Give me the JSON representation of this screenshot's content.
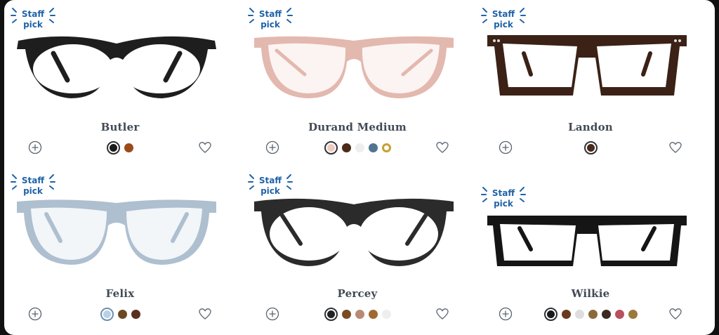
{
  "badge": {
    "line1": "Staff",
    "line2": "pick"
  },
  "products": [
    {
      "name": "Butler",
      "staff_pick": true,
      "frame_color": "#1e1e1e",
      "lens_tint": "none",
      "swatches": [
        "#1b1b1b",
        "#9b4a18"
      ],
      "selected": 0
    },
    {
      "name": "Durand Medium",
      "staff_pick": true,
      "frame_color": "#e3b8ae",
      "lens_tint": "none",
      "swatches": [
        "#f1c9c1",
        "#4a2a18",
        "#eeeeee",
        "#4f7590",
        "#c99f34"
      ],
      "selected": 0
    },
    {
      "name": "Landon",
      "staff_pick": true,
      "frame_color": "#3b2116",
      "lens_tint": "none",
      "swatches": [
        "#4b2a1b"
      ],
      "selected": 0
    },
    {
      "name": "Felix",
      "staff_pick": true,
      "frame_color": "#aebfcf",
      "lens_tint": "none",
      "swatches": [
        "#b7d1e6",
        "#6b4a22",
        "#5a3020"
      ],
      "selected": 0
    },
    {
      "name": "Percey",
      "staff_pick": true,
      "frame_color": "#2b2b2b",
      "lens_tint": "none",
      "swatches": [
        "#222222",
        "#7a4a22",
        "#b88a74",
        "#a06a30",
        "#eeeeee"
      ],
      "selected": 0
    },
    {
      "name": "Wilkie",
      "staff_pick": true,
      "frame_color": "#151515",
      "lens_tint": "none",
      "swatches": [
        "#1a1a1a",
        "#6a3a1e",
        "#dddddd",
        "#8a6a3a",
        "#3a2a22",
        "#b8505e",
        "#9a7a3a"
      ],
      "selected": 0
    }
  ],
  "icons": {
    "add": "plus-circle-icon",
    "favorite": "heart-outline-icon"
  },
  "colors": {
    "badge_blue": "#1f63a8",
    "name_text": "#414b56",
    "icon_gray": "#5a6470"
  }
}
